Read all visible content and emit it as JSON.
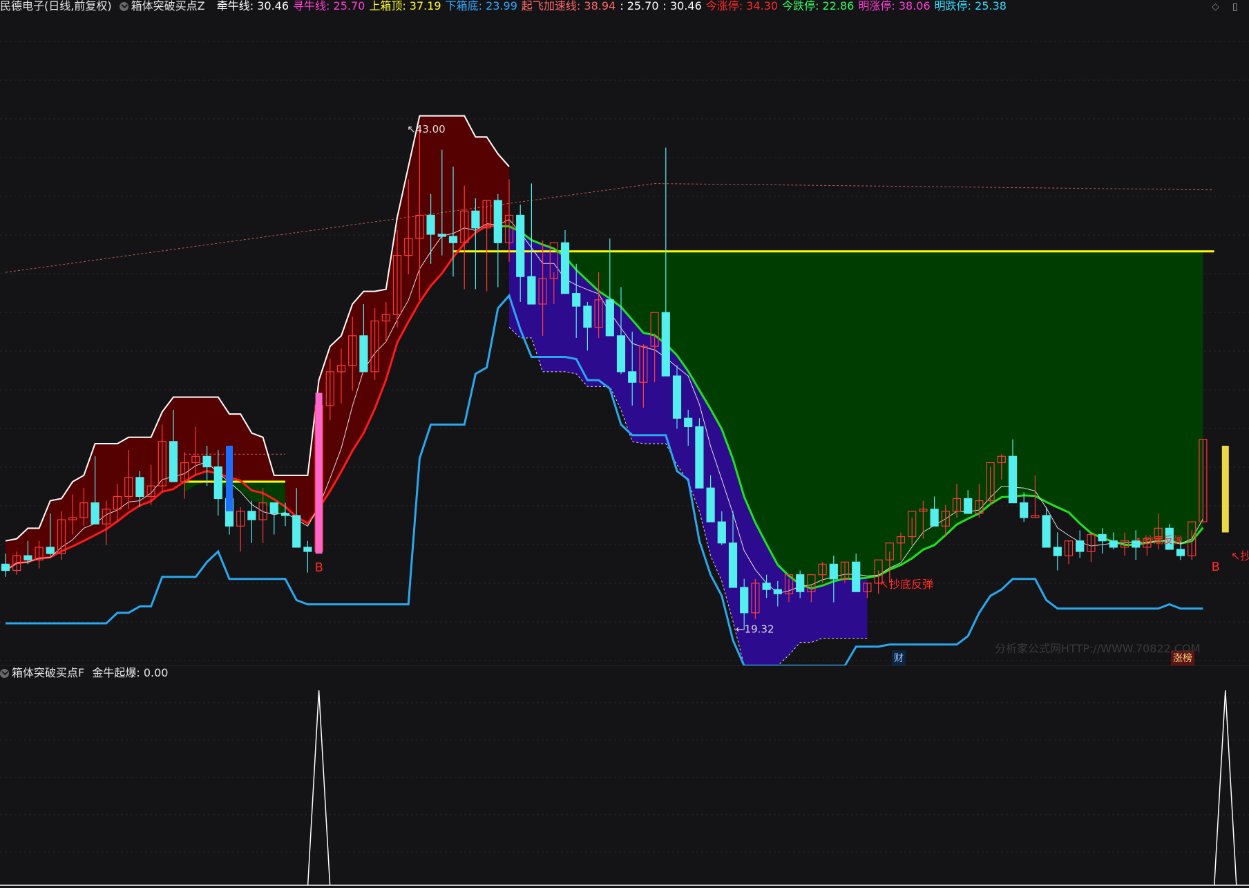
{
  "header": {
    "stock_name": "民德电子(日线,前复权)",
    "indicator_main": "箱体突破买点Z",
    "items": [
      {
        "label": "牵牛线:",
        "value": "30.46",
        "color": "#ffffff"
      },
      {
        "label": "寻牛线:",
        "value": "25.70",
        "color": "#ff3fd5"
      },
      {
        "label": "上箱顶:",
        "value": "37.19",
        "color": "#ffff33"
      },
      {
        "label": "下箱底:",
        "value": "23.99",
        "color": "#33aaff"
      },
      {
        "label": "起飞加速线:",
        "value": "38.94",
        "color": "#ff6a6a"
      },
      {
        "label": ":",
        "value": "25.70",
        "color": "#ffffff"
      },
      {
        "label": ":",
        "value": "30.46",
        "color": "#ffffff"
      },
      {
        "label": "今涨停:",
        "value": "34.30",
        "color": "#ff2a2a"
      },
      {
        "label": "今跌停:",
        "value": "22.86",
        "color": "#33ff66"
      },
      {
        "label": "明涨停:",
        "value": "38.06",
        "color": "#ff3fd5"
      },
      {
        "label": "明跌停:",
        "value": "25.38",
        "color": "#33ddff"
      }
    ]
  },
  "sub_header": {
    "indicator": "箱体突破买点F",
    "label": "金牛起爆:",
    "value": "0.00"
  },
  "annotations": {
    "high_label": "43.00",
    "low_label": "19.32",
    "buy_marker": "B",
    "rebound_label": "抄底反弹",
    "rebound_label_alt": "抄底反弹"
  },
  "badges": {
    "cai": "财",
    "zhangbang": "涨榜"
  },
  "watermark": "分析家公式网HTTP://WWW.70822.COM",
  "colors": {
    "up": "#ff3b3b",
    "down": "#55eeee",
    "upper_fill": "#5a0000",
    "box_fill": "#003d00",
    "lower_fill": "#2c0b8f",
    "white_line": "#ffffff",
    "green_line": "#22e022",
    "red_line": "#ff1a1a",
    "yellow_line": "#ffff00",
    "blue_line": "#2aa8ee"
  },
  "chart_data": {
    "type": "candlestick",
    "ylim": [
      18,
      46
    ],
    "candles": [
      [
        22.4,
        22.9,
        21.8,
        22.1
      ],
      [
        22.1,
        23.0,
        21.9,
        22.8
      ],
      [
        22.8,
        23.5,
        22.4,
        22.6
      ],
      [
        22.6,
        23.5,
        22.2,
        23.2
      ],
      [
        23.2,
        24.8,
        22.8,
        22.9
      ],
      [
        22.9,
        24.9,
        22.6,
        24.5
      ],
      [
        24.5,
        25.7,
        23.8,
        24.6
      ],
      [
        24.6,
        26.0,
        24.2,
        25.3
      ],
      [
        25.3,
        27.5,
        24.7,
        24.3
      ],
      [
        24.3,
        25.4,
        23.3,
        25.0
      ],
      [
        25.0,
        26.2,
        24.4,
        25.6
      ],
      [
        25.6,
        27.8,
        25.0,
        26.5
      ],
      [
        26.5,
        26.8,
        25.1,
        25.6
      ],
      [
        25.6,
        27.1,
        25.2,
        26.1
      ],
      [
        26.1,
        29.0,
        25.8,
        28.2
      ],
      [
        28.2,
        29.7,
        27.9,
        26.3
      ],
      [
        26.3,
        27.7,
        25.5,
        27.2
      ],
      [
        27.2,
        28.9,
        26.6,
        27.5
      ],
      [
        27.5,
        28.0,
        26.1,
        27.0
      ],
      [
        27.0,
        27.8,
        24.7,
        25.5
      ],
      [
        25.5,
        25.8,
        23.8,
        24.2
      ],
      [
        24.2,
        25.1,
        23.0,
        24.9
      ],
      [
        24.9,
        25.4,
        23.4,
        24.5
      ],
      [
        24.5,
        26.0,
        23.4,
        25.3
      ],
      [
        25.3,
        25.3,
        23.8,
        24.8
      ],
      [
        24.8,
        25.3,
        24.2,
        24.7
      ],
      [
        24.7,
        26.0,
        23.6,
        23.2
      ],
      [
        23.2,
        23.5,
        22.0,
        23.0
      ],
      [
        23.0,
        30.5,
        22.9,
        29.9
      ],
      [
        29.9,
        32.1,
        29.2,
        31.5
      ],
      [
        31.5,
        32.6,
        30.0,
        31.8
      ],
      [
        31.8,
        34.1,
        30.6,
        33.2
      ],
      [
        33.2,
        34.7,
        31.9,
        31.5
      ],
      [
        31.5,
        34.5,
        31.1,
        33.9
      ],
      [
        33.9,
        34.8,
        32.9,
        34.2
      ],
      [
        34.2,
        38.2,
        33.6,
        37.0
      ],
      [
        37.0,
        40.6,
        36.1,
        37.8
      ],
      [
        37.8,
        43.0,
        34.9,
        38.9
      ],
      [
        38.9,
        39.9,
        36.6,
        38.0
      ],
      [
        38.0,
        42.0,
        37.0,
        37.9
      ],
      [
        37.9,
        41.2,
        36.0,
        37.6
      ],
      [
        37.6,
        40.3,
        35.4,
        39.1
      ],
      [
        39.1,
        39.7,
        35.4,
        38.3
      ],
      [
        38.3,
        39.6,
        35.3,
        39.6
      ],
      [
        39.6,
        39.9,
        35.5,
        37.6
      ],
      [
        37.6,
        40.6,
        36.7,
        38.9
      ],
      [
        38.9,
        39.4,
        34.8,
        36.0
      ],
      [
        36.0,
        40.4,
        35.7,
        34.7
      ],
      [
        34.7,
        37.7,
        33.2,
        35.9
      ],
      [
        35.9,
        36.2,
        34.7,
        37.6
      ],
      [
        37.6,
        38.2,
        35.6,
        35.2
      ],
      [
        35.2,
        36.6,
        33.1,
        34.6
      ],
      [
        34.6,
        34.8,
        32.5,
        33.6
      ],
      [
        33.6,
        36.2,
        33.1,
        34.9
      ],
      [
        34.9,
        37.8,
        33.3,
        33.2
      ],
      [
        33.2,
        35.5,
        31.4,
        31.5
      ],
      [
        31.5,
        33.4,
        29.9,
        31.0
      ],
      [
        31.0,
        32.8,
        29.8,
        32.7
      ],
      [
        32.7,
        33.3,
        31.0,
        34.3
      ],
      [
        34.3,
        42.1,
        32.1,
        31.3
      ],
      [
        31.3,
        31.8,
        28.8,
        29.3
      ],
      [
        29.3,
        29.7,
        28.0,
        28.9
      ],
      [
        28.9,
        29.3,
        26.6,
        26.0
      ],
      [
        26.0,
        26.6,
        24.5,
        24.4
      ],
      [
        24.4,
        24.9,
        23.3,
        23.4
      ],
      [
        23.4,
        24.9,
        21.4,
        21.3
      ],
      [
        21.3,
        21.7,
        19.3,
        20.1
      ],
      [
        20.1,
        21.7,
        19.8,
        21.5
      ],
      [
        21.5,
        21.9,
        20.8,
        21.2
      ],
      [
        21.2,
        21.6,
        20.4,
        21.0
      ],
      [
        21.0,
        21.7,
        20.6,
        21.9
      ],
      [
        21.9,
        22.1,
        20.8,
        21.1
      ],
      [
        21.1,
        21.4,
        20.6,
        21.9
      ],
      [
        21.9,
        22.5,
        21.5,
        22.4
      ],
      [
        22.4,
        22.8,
        20.6,
        21.7
      ],
      [
        21.7,
        22.5,
        21.5,
        22.5
      ],
      [
        22.5,
        22.9,
        21.1,
        21.1
      ],
      [
        21.1,
        21.5,
        20.8,
        21.5
      ],
      [
        21.5,
        22.1,
        21.0,
        22.6
      ],
      [
        22.6,
        23.0,
        21.5,
        23.4
      ],
      [
        23.4,
        23.9,
        22.6,
        23.7
      ],
      [
        23.7,
        24.6,
        23.3,
        24.9
      ],
      [
        24.9,
        25.4,
        23.6,
        25.0
      ],
      [
        25.0,
        25.6,
        24.2,
        24.2
      ],
      [
        24.2,
        25.2,
        23.7,
        24.9
      ],
      [
        24.9,
        26.2,
        24.6,
        25.5
      ],
      [
        25.5,
        25.9,
        24.8,
        24.8
      ],
      [
        24.8,
        26.2,
        24.6,
        25.4
      ],
      [
        25.4,
        27.0,
        25.2,
        27.2
      ],
      [
        27.2,
        27.6,
        26.4,
        27.5
      ],
      [
        27.5,
        28.3,
        26.5,
        25.3
      ],
      [
        25.3,
        25.8,
        24.4,
        24.6
      ],
      [
        24.6,
        26.6,
        24.6,
        24.7
      ],
      [
        24.7,
        25.1,
        23.2,
        23.2
      ],
      [
        23.2,
        23.9,
        22.1,
        22.8
      ],
      [
        22.8,
        23.5,
        22.4,
        23.5
      ],
      [
        23.5,
        24.0,
        22.7,
        23.0
      ],
      [
        23.0,
        23.8,
        22.5,
        23.8
      ],
      [
        23.8,
        24.1,
        22.9,
        23.5
      ],
      [
        23.5,
        23.9,
        23.1,
        23.2
      ],
      [
        23.2,
        23.9,
        22.8,
        23.5
      ],
      [
        23.5,
        24.0,
        22.6,
        23.2
      ],
      [
        23.2,
        23.6,
        22.8,
        23.6
      ],
      [
        23.6,
        24.8,
        23.1,
        24.1
      ],
      [
        24.1,
        24.3,
        23.1,
        23.1
      ],
      [
        23.1,
        23.5,
        22.6,
        22.8
      ],
      [
        22.8,
        24.0,
        22.6,
        24.4
      ],
      [
        24.4,
        28.3,
        24.4,
        28.3
      ]
    ],
    "upper_box": 37.19,
    "lower_box": 23.99
  }
}
